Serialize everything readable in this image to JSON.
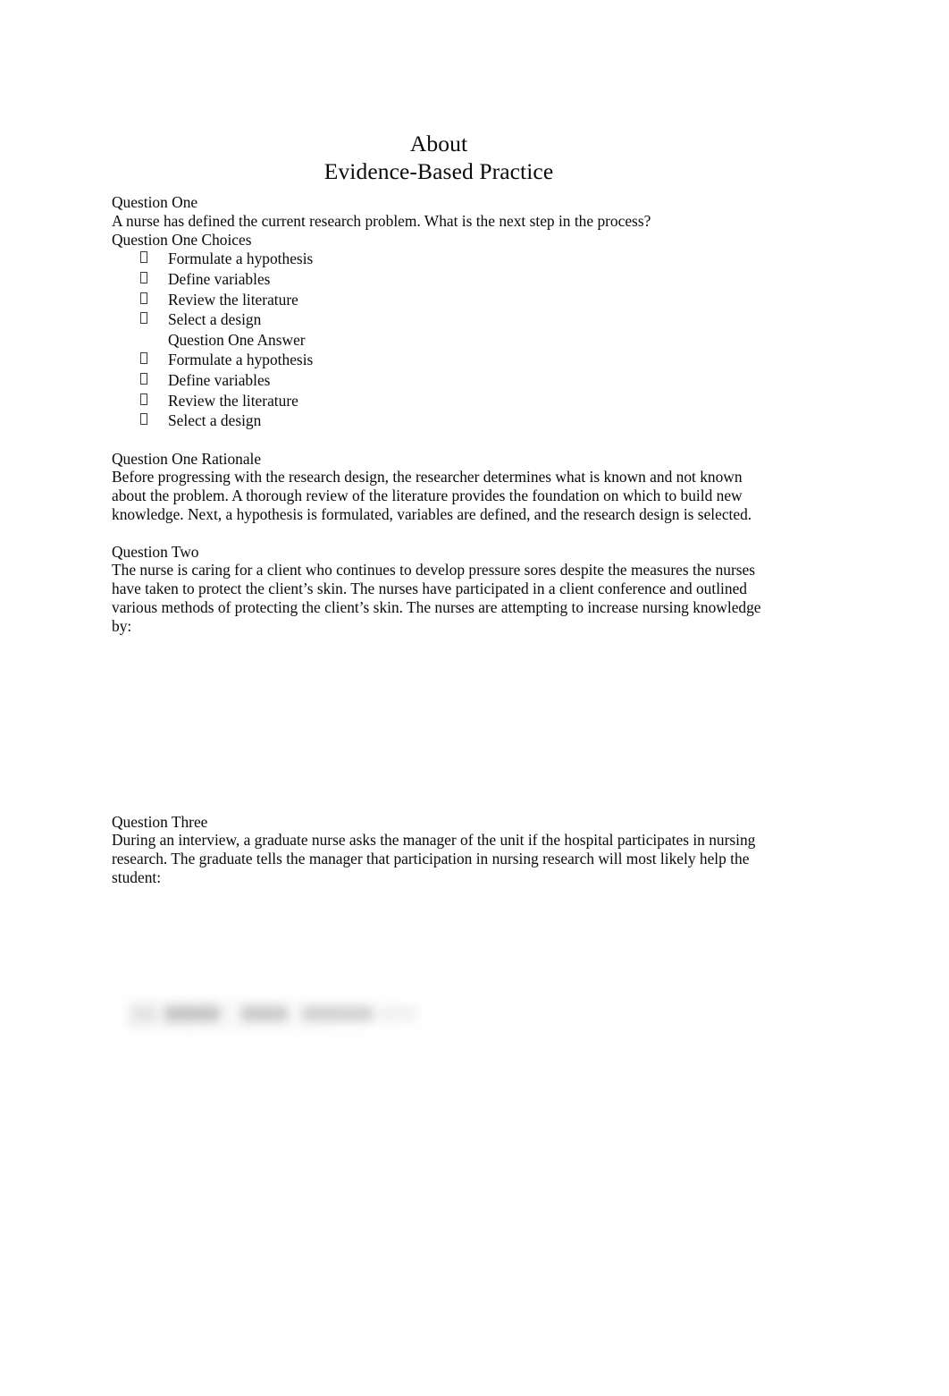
{
  "document": {
    "title_line1": "About",
    "title_line2": "Evidence-Based Practice",
    "bullet_glyph_name": "missing-glyph-box-bullet"
  },
  "question_one": {
    "heading": "Question One",
    "stem": "A nurse has defined the current research problem. What is the next step in the process?",
    "choices_label": "Question One Choices",
    "choices": [
      "Formulate a hypothesis",
      "Define variables",
      "Review the literature",
      "Select a design"
    ],
    "answer_label": "Question One Answer",
    "answer_choices": [
      "Formulate a hypothesis",
      "Define variables",
      "Review the literature",
      "Select a design"
    ],
    "rationale_label": "Question One Rationale",
    "rationale": "Before progressing with the research design, the researcher determines what is known and not known about the problem. A thorough review of the literature provides the foundation on which to build new knowledge. Next, a hypothesis is formulated, variables are defined, and the research design is selected."
  },
  "question_two": {
    "heading": "Question Two",
    "stem": "The nurse is caring for a client who continues to develop pressure sores despite the measures the nurses have taken to protect the client’s skin. The nurses have participated in a client conference and outlined various methods of protecting the client’s skin. The nurses are attempting to increase nursing knowledge by:"
  },
  "question_three": {
    "heading": "Question Three",
    "stem": "During an interview, a graduate nurse asks the manager of the unit if the hospital participates in nursing research. The graduate tells the manager that participation in nursing research will most likely help the student:"
  },
  "redacted": {
    "name": "blurred-illegible-text-line"
  }
}
